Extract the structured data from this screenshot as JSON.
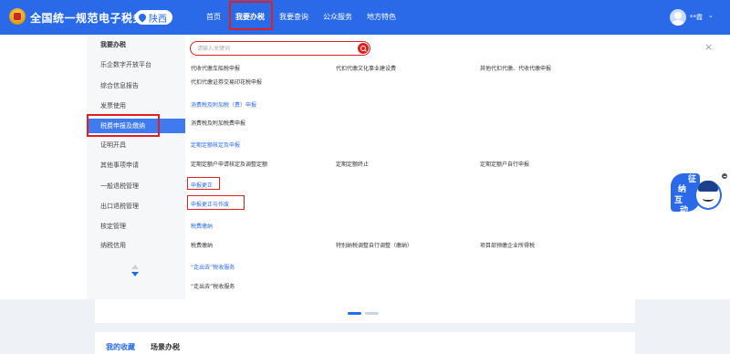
{
  "header": {
    "site_title": "全国统一规范电子税务局",
    "region": "陕西",
    "nav": [
      {
        "label": "首页",
        "active": false
      },
      {
        "label": "我要办税",
        "active": true
      },
      {
        "label": "我要查询",
        "active": false
      },
      {
        "label": "公众服务",
        "active": false
      },
      {
        "label": "地方特色",
        "active": false
      }
    ],
    "user_name": "**霞",
    "user_chevron": "⌄"
  },
  "sidebar": {
    "title": "我要办税",
    "items": [
      {
        "label": "乐企数字开放平台",
        "active": false
      },
      {
        "label": "综合信息报告",
        "active": false
      },
      {
        "label": "发票使用",
        "active": false
      },
      {
        "label": "税费申报及缴纳",
        "active": true
      },
      {
        "label": "证明开具",
        "active": false
      },
      {
        "label": "其他事项申请",
        "active": false
      },
      {
        "label": "一般退税管理",
        "active": false
      },
      {
        "label": "出口退税管理",
        "active": false
      },
      {
        "label": "核定管理",
        "active": false
      },
      {
        "label": "纳税信用",
        "active": false
      }
    ]
  },
  "search": {
    "placeholder": "请输入关键词"
  },
  "close_symbol": "×",
  "content": {
    "row1": [
      "代收代缴车船税申报",
      "代扣代缴文化事业建设费",
      "其他代扣代缴、代收代缴申报"
    ],
    "row1b": "代扣代缴证券交易印花税申报",
    "cat_consumption": "消费税及附加税（费）申报",
    "consumption_item": "消费税及附加税费申报",
    "cat_fixed": "定期定额核定及申报",
    "fixed_items": [
      "定期定额户申请核定及调整定额",
      "定期定额终止",
      "定期定额户自行申报"
    ],
    "cat_correction": "申报更正",
    "cat_void": "申报更正与作废",
    "cat_payment": "税费缴纳",
    "payment_items": [
      "税费缴纳",
      "特别纳税调整自行调整（缴纳）",
      "项目部预缴企业所得税"
    ],
    "cat_goout": "“走出去”税收服务",
    "goout_item": "“走出去”税收服务"
  },
  "helper": {
    "chars": [
      "征",
      "纳",
      "互",
      "动"
    ]
  },
  "bottom_tabs": [
    {
      "label": "我的收藏",
      "active": true
    },
    {
      "label": "场景办税",
      "active": false
    }
  ],
  "colors": {
    "brand_blue": "#2a6ae8",
    "highlight_red": "#e02020",
    "active_blue": "#3f7bef"
  }
}
